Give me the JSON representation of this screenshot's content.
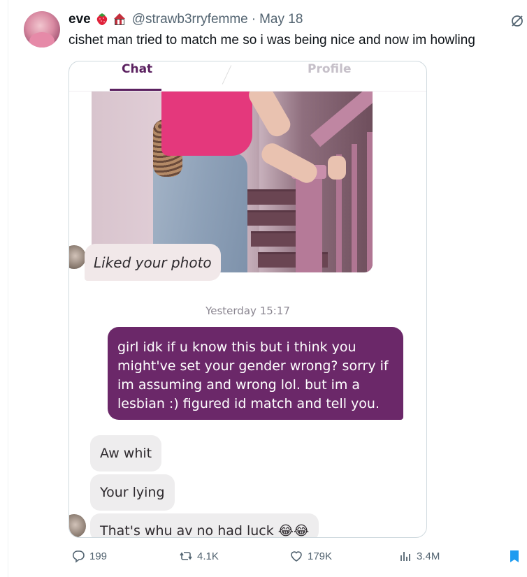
{
  "tweet": {
    "display_name": "eve",
    "handle": "@strawb3rryfemme",
    "separator": "·",
    "date": "May 18",
    "text": "cishet man tried to match me so i was being nice and now im howling",
    "name_emojis": [
      "strawberry-emoji",
      "circus-tent-emoji"
    ]
  },
  "media": {
    "tabs": [
      {
        "label": "Chat",
        "active": true
      },
      {
        "label": "Profile",
        "active": false
      }
    ],
    "liked_photo_text": "Liked your photo",
    "timestamp_label": "Yesterday",
    "timestamp_time": "15:17",
    "sent_message": "girl idk if u know this but i think you might've set your gender wrong? sorry if im assuming and wrong lol. but im a lesbian :) figured id match and tell you.",
    "replies": [
      "Aw whit",
      "Your lying",
      "That's whu av no had luck 😂😂"
    ],
    "colors": {
      "accent": "#5b2160",
      "sent_bubble": "#6b2869",
      "received_bubble": "#eeedee"
    }
  },
  "actions": {
    "replies": "199",
    "retweets": "4.1K",
    "likes": "179K",
    "views": "3.4M"
  },
  "colors": {
    "bookmark": "#1d9bf0",
    "muted_text": "#536471"
  }
}
